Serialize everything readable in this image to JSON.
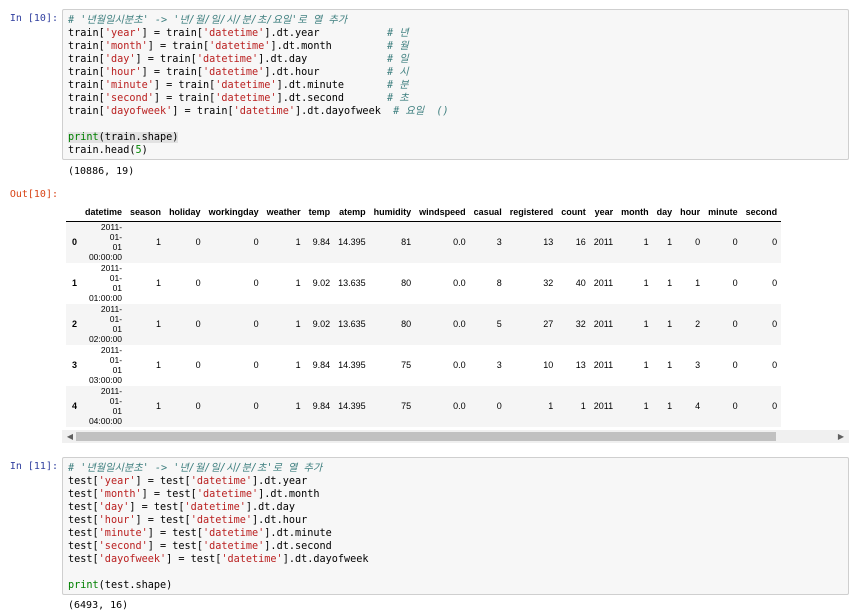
{
  "cell10": {
    "in_prompt": "In [10]:",
    "out_prompt": "Out[10]:",
    "comment": "# '년월일시분초' -> '년/월/일/시/분/초/요일'로 열 추가",
    "lines": [
      {
        "lhs": "train[",
        "key": "'year'",
        "mid": "] = train[",
        "col": "'datetime'",
        "rest": "].dt.year           ",
        "cmt": "# 년"
      },
      {
        "lhs": "train[",
        "key": "'month'",
        "mid": "] = train[",
        "col": "'datetime'",
        "rest": "].dt.month         ",
        "cmt": "# 월"
      },
      {
        "lhs": "train[",
        "key": "'day'",
        "mid": "] = train[",
        "col": "'datetime'",
        "rest": "].dt.day             ",
        "cmt": "# 일"
      },
      {
        "lhs": "train[",
        "key": "'hour'",
        "mid": "] = train[",
        "col": "'datetime'",
        "rest": "].dt.hour           ",
        "cmt": "# 시"
      },
      {
        "lhs": "train[",
        "key": "'minute'",
        "mid": "] = train[",
        "col": "'datetime'",
        "rest": "].dt.minute       ",
        "cmt": "# 분"
      },
      {
        "lhs": "train[",
        "key": "'second'",
        "mid": "] = train[",
        "col": "'datetime'",
        "rest": "].dt.second       ",
        "cmt": "# 초"
      },
      {
        "lhs": "train[",
        "key": "'dayofweek'",
        "mid": "] = train[",
        "col": "'datetime'",
        "rest": "].dt.dayofweek  ",
        "cmt": "# 요일  ()"
      }
    ],
    "print_fn": "print",
    "print_args": "(train.shape)",
    "head_line": "train.head(",
    "head_num": "5",
    "head_close": ")",
    "stdout": "(10886, 19)"
  },
  "dataframe": {
    "columns": [
      "",
      "datetime",
      "season",
      "holiday",
      "workingday",
      "weather",
      "temp",
      "atemp",
      "humidity",
      "windspeed",
      "casual",
      "registered",
      "count",
      "year",
      "month",
      "day",
      "hour",
      "minute",
      "second"
    ],
    "rows": [
      {
        "index": "0",
        "datetime": [
          "2011-",
          "01-",
          "01",
          "00:00:00"
        ],
        "cells": [
          "1",
          "0",
          "0",
          "1",
          "9.84",
          "14.395",
          "81",
          "0.0",
          "3",
          "13",
          "16",
          "2011",
          "1",
          "1",
          "0",
          "0",
          "0"
        ]
      },
      {
        "index": "1",
        "datetime": [
          "2011-",
          "01-",
          "01",
          "01:00:00"
        ],
        "cells": [
          "1",
          "0",
          "0",
          "1",
          "9.02",
          "13.635",
          "80",
          "0.0",
          "8",
          "32",
          "40",
          "2011",
          "1",
          "1",
          "1",
          "0",
          "0"
        ]
      },
      {
        "index": "2",
        "datetime": [
          "2011-",
          "01-",
          "01",
          "02:00:00"
        ],
        "cells": [
          "1",
          "0",
          "0",
          "1",
          "9.02",
          "13.635",
          "80",
          "0.0",
          "5",
          "27",
          "32",
          "2011",
          "1",
          "1",
          "2",
          "0",
          "0"
        ]
      },
      {
        "index": "3",
        "datetime": [
          "2011-",
          "01-",
          "01",
          "03:00:00"
        ],
        "cells": [
          "1",
          "0",
          "0",
          "1",
          "9.84",
          "14.395",
          "75",
          "0.0",
          "3",
          "10",
          "13",
          "2011",
          "1",
          "1",
          "3",
          "0",
          "0"
        ]
      },
      {
        "index": "4",
        "datetime": [
          "2011-",
          "01-",
          "01",
          "04:00:00"
        ],
        "cells": [
          "1",
          "0",
          "0",
          "1",
          "9.84",
          "14.395",
          "75",
          "0.0",
          "0",
          "1",
          "1",
          "2011",
          "1",
          "1",
          "4",
          "0",
          "0"
        ]
      }
    ]
  },
  "cell11": {
    "in_prompt": "In [11]:",
    "comment": "# '년월일시분초' -> '년/월/일/시/분/초'로 열 추가",
    "lines": [
      {
        "lhs": "test[",
        "key": "'year'",
        "mid": "] = test[",
        "col": "'datetime'",
        "rest": "].dt.year"
      },
      {
        "lhs": "test[",
        "key": "'month'",
        "mid": "] = test[",
        "col": "'datetime'",
        "rest": "].dt.month"
      },
      {
        "lhs": "test[",
        "key": "'day'",
        "mid": "] = test[",
        "col": "'datetime'",
        "rest": "].dt.day"
      },
      {
        "lhs": "test[",
        "key": "'hour'",
        "mid": "] = test[",
        "col": "'datetime'",
        "rest": "].dt.hour"
      },
      {
        "lhs": "test[",
        "key": "'minute'",
        "mid": "] = test[",
        "col": "'datetime'",
        "rest": "].dt.minute"
      },
      {
        "lhs": "test[",
        "key": "'second'",
        "mid": "] = test[",
        "col": "'datetime'",
        "rest": "].dt.second"
      },
      {
        "lhs": "test[",
        "key": "'dayofweek'",
        "mid": "] = test[",
        "col": "'datetime'",
        "rest": "].dt.dayofweek"
      }
    ],
    "print_fn": "print",
    "print_args": "(test.shape)",
    "stdout": "(6493, 16)"
  },
  "scrollbar": {
    "left_arrow": "◀",
    "right_arrow": "▶"
  },
  "colors": {
    "in_prompt": "#303F9F",
    "out_prompt": "#D84315",
    "string": "#BA2121",
    "comment": "#408080",
    "builtin": "#008000"
  }
}
